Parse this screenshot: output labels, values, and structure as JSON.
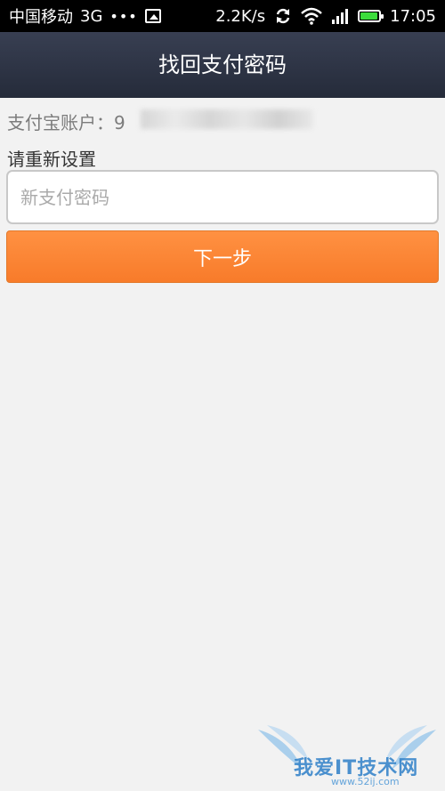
{
  "status_bar": {
    "carrier": "中国移动",
    "network": "3G",
    "dots": "•••",
    "speed": "2.2K/s",
    "time": "17:05",
    "battery_level": 0.95,
    "battery_color": "#3ddc3d"
  },
  "header": {
    "title": "找回支付密码"
  },
  "account": {
    "label": "支付宝账户：",
    "value_visible": "9"
  },
  "reset": {
    "label": "请重新设置"
  },
  "password_input": {
    "value": "",
    "placeholder": "新支付密码"
  },
  "next_button": {
    "label": "下一步",
    "color": "#f98332"
  },
  "icons": [
    "picture-icon",
    "sync-icon",
    "wifi-icon",
    "signal-icon",
    "battery-icon"
  ],
  "watermark": {
    "text": "我爱IT技术网",
    "url": "www.52ij.com"
  }
}
